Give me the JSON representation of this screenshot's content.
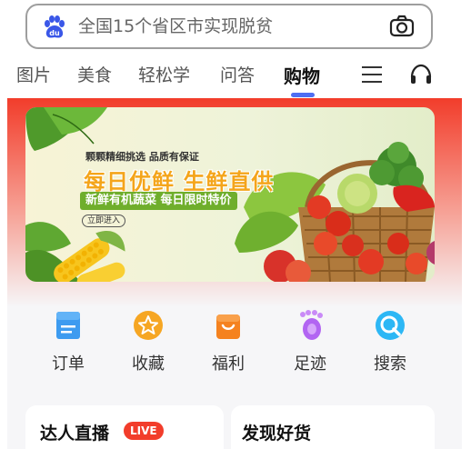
{
  "search": {
    "query_text": "全国15个省区市实现脱贫",
    "logo_text": "du"
  },
  "tabs": [
    {
      "label": "图片",
      "active": false
    },
    {
      "label": "美食",
      "active": false
    },
    {
      "label": "轻松学",
      "active": false
    },
    {
      "label": "问答",
      "active": false
    },
    {
      "label": "购物",
      "active": true
    }
  ],
  "banner": {
    "pre_title": "颗颗精细挑选  品质有保证",
    "title": "每日优鲜  生鲜直供",
    "subtitle": "新鲜有机蔬菜  每日限时特价",
    "cta": "立即进入"
  },
  "services": [
    {
      "label": "订单",
      "icon": "order-icon",
      "color": "#3d9bf0"
    },
    {
      "label": "收藏",
      "icon": "star-icon",
      "color": "#f6a623"
    },
    {
      "label": "福利",
      "icon": "gift-bag-icon",
      "color": "#f5821f"
    },
    {
      "label": "足迹",
      "icon": "footprint-icon",
      "color": "#b265f2"
    },
    {
      "label": "搜索",
      "icon": "search-icon",
      "color": "#2db7f5"
    }
  ],
  "cards": {
    "left_title": "达人直播",
    "live_badge": "LIVE",
    "right_title": "发现好货"
  },
  "colors": {
    "accent": "#4e6ef2",
    "header_red": "#f23d2b",
    "live_red": "#f23d2b"
  }
}
